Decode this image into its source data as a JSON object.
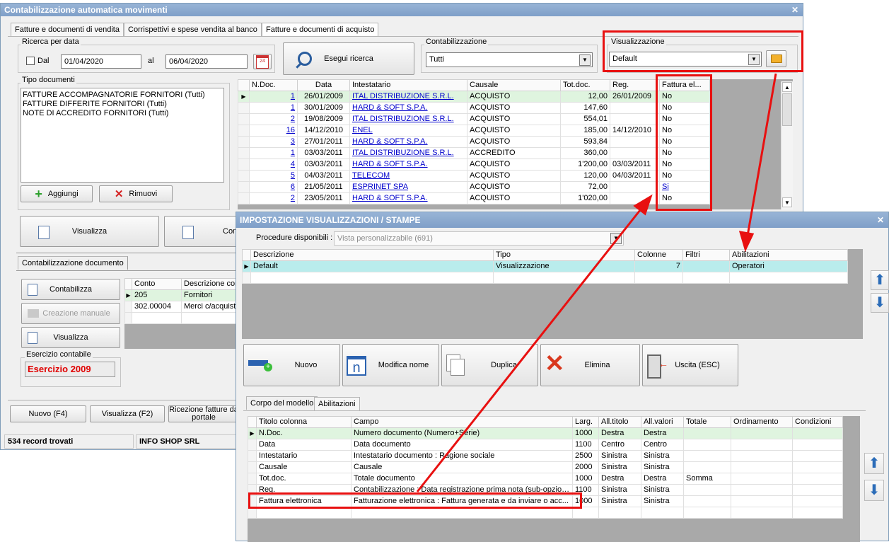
{
  "main_window": {
    "title": "Contabilizzazione automatica movimenti",
    "tabs": [
      "Fatture e documenti di vendita",
      "Corrispettivi e spese vendita al banco",
      "Fatture e documenti di acquisto"
    ],
    "ricerca": {
      "group_label": "Ricerca per data",
      "dal_label": "Dal",
      "from_date": "01/04/2020",
      "al_label": "al",
      "to_date": "06/04/2020",
      "calendar_badge": "24"
    },
    "esegui_label": "Esegui ricerca",
    "contabilizzazione": {
      "group_label": "Contabilizzazione",
      "value": "Tutti"
    },
    "visualizzazione": {
      "group_label": "Visualizzazione",
      "value": "Default"
    },
    "tipo_documenti": {
      "group_label": "Tipo documenti",
      "items": [
        "FATTURE ACCOMPAGNATORIE FORNITORI (Tutti)",
        "FATTURE DIFFERITE FORNITORI (Tutti)",
        "NOTE DI ACCREDITO FORNITORI (Tutti)"
      ],
      "add_label": "Aggiungi",
      "remove_label": "Rimuovi"
    },
    "grid": {
      "headers": [
        "N.Doc.",
        "Data",
        "Intestatario",
        "Causale",
        "Tot.doc.",
        "Reg.",
        "Fattura el..."
      ],
      "rows": [
        {
          "ndoc": "1",
          "data": "26/01/2009",
          "intestatario": "ITAL DISTRIBUZIONE S.R.L.",
          "causale": "ACQUISTO",
          "tot": "12,00",
          "reg": "26/01/2009",
          "fe": "No"
        },
        {
          "ndoc": "1",
          "data": "30/01/2009",
          "intestatario": "HARD & SOFT S.P.A.",
          "causale": "ACQUISTO",
          "tot": "147,60",
          "reg": "",
          "fe": "No"
        },
        {
          "ndoc": "2",
          "data": "19/08/2009",
          "intestatario": "ITAL DISTRIBUZIONE S.R.L.",
          "causale": "ACQUISTO",
          "tot": "554,01",
          "reg": "",
          "fe": "No"
        },
        {
          "ndoc": "16",
          "data": "14/12/2010",
          "intestatario": "ENEL",
          "causale": "ACQUISTO",
          "tot": "185,00",
          "reg": "14/12/2010",
          "fe": "No"
        },
        {
          "ndoc": "3",
          "data": "27/01/2011",
          "intestatario": "HARD & SOFT S.P.A.",
          "causale": "ACQUISTO",
          "tot": "593,84",
          "reg": "",
          "fe": "No"
        },
        {
          "ndoc": "1",
          "data": "03/03/2011",
          "intestatario": "ITAL DISTRIBUZIONE S.R.L.",
          "causale": "ACCREDITO",
          "tot": "360,00",
          "reg": "",
          "fe": "No"
        },
        {
          "ndoc": "4",
          "data": "03/03/2011",
          "intestatario": "HARD & SOFT S.P.A.",
          "causale": "ACQUISTO",
          "tot": "1'200,00",
          "reg": "03/03/2011",
          "fe": "No"
        },
        {
          "ndoc": "5",
          "data": "04/03/2011",
          "intestatario": "TELECOM",
          "causale": "ACQUISTO",
          "tot": "120,00",
          "reg": "04/03/2011",
          "fe": "No"
        },
        {
          "ndoc": "6",
          "data": "21/05/2011",
          "intestatario": "ESPRINET SPA",
          "causale": "ACQUISTO",
          "tot": "72,00",
          "reg": "",
          "fe": "Si"
        },
        {
          "ndoc": "2",
          "data": "23/05/2011",
          "intestatario": "HARD & SOFT S.P.A.",
          "causale": "ACQUISTO",
          "tot": "1'020,00",
          "reg": "",
          "fe": "No"
        }
      ]
    },
    "visualizza_label": "Visualizza",
    "con_partial_label": "Con",
    "contab_doc": {
      "tab_label": "Contabilizzazione documento",
      "contabilizza_label": "Contabilizza",
      "creazione_label": "Creazione manuale",
      "visualizza_label": "Visualizza",
      "headers": [
        "Conto",
        "Descrizione con"
      ],
      "rows": [
        [
          "205",
          "Fornitori"
        ],
        [
          "302.00004",
          "Merci c/acquisti"
        ]
      ],
      "esercizio_group": "Esercizio contabile",
      "esercizio_value": "Esercizio 2009"
    },
    "bottom_buttons": {
      "nuovo": "Nuovo (F4)",
      "visualizza": "Visualizza (F2)",
      "ricezione_line1": "Ricezione fatture da",
      "ricezione_line2": "portale"
    },
    "status": {
      "records": "534 record trovati",
      "company": "INFO SHOP SRL"
    }
  },
  "dialog": {
    "title": "IMPOSTAZIONE VISUALIZZAZIONI / STAMPE",
    "procedure_label": "Procedure disponibili :",
    "procedure_value": "Vista personalizzabile (691)",
    "views": {
      "headers": [
        "Descrizione",
        "Tipo",
        "Colonne",
        "Filtri",
        "Abilitazioni"
      ],
      "rows": [
        {
          "descrizione": "Default",
          "tipo": "Visualizzazione",
          "colonne": "7",
          "filtri": "",
          "abilitazioni": "Operatori"
        }
      ]
    },
    "buttons": {
      "nuovo": "Nuovo",
      "modifica": "Modifica nome",
      "duplica": "Duplica",
      "elimina": "Elimina",
      "uscita": "Uscita (ESC)"
    },
    "tabs": [
      "Corpo del modello",
      "Abilitazioni"
    ],
    "columns": {
      "headers": [
        "Titolo colonna",
        "Campo",
        "Larg.",
        "All.titolo",
        "All.valori",
        "Totale",
        "Ordinamento",
        "Condizioni"
      ],
      "rows": [
        {
          "titolo": "N.Doc.",
          "campo": "Numero documento (Numero+Serie)",
          "larg": "1000",
          "alltit": "Destra",
          "allval": "Destra",
          "tot": "",
          "ord": "",
          "cond": ""
        },
        {
          "titolo": "Data",
          "campo": "Data documento",
          "larg": "1100",
          "alltit": "Centro",
          "allval": "Centro",
          "tot": "",
          "ord": "",
          "cond": ""
        },
        {
          "titolo": "Intestatario",
          "campo": "Intestatario documento : Ragione sociale",
          "larg": "2500",
          "alltit": "Sinistra",
          "allval": "Sinistra",
          "tot": "",
          "ord": "",
          "cond": ""
        },
        {
          "titolo": "Causale",
          "campo": "Causale",
          "larg": "2000",
          "alltit": "Sinistra",
          "allval": "Sinistra",
          "tot": "",
          "ord": "",
          "cond": ""
        },
        {
          "titolo": "Tot.doc.",
          "campo": "Totale documento",
          "larg": "1000",
          "alltit": "Destra",
          "allval": "Destra",
          "tot": "Somma",
          "ord": "",
          "cond": ""
        },
        {
          "titolo": "Reg.",
          "campo": "Contabilizzazione : Data registrazione prima nota (sub-opzione)",
          "larg": "1100",
          "alltit": "Sinistra",
          "allval": "Sinistra",
          "tot": "",
          "ord": "",
          "cond": ""
        },
        {
          "titolo": "Fattura elettronica",
          "campo": "Fatturazione elettronica : Fattura generata e da inviare o acc...",
          "larg": "1000",
          "alltit": "Sinistra",
          "allval": "Sinistra",
          "tot": "",
          "ord": "",
          "cond": ""
        }
      ]
    }
  },
  "colors": {
    "highlight_red": "#e81010",
    "selected_row": "#dff4df",
    "selected_row_cyan": "#b9ecec",
    "title_blue": "#7f9fc8",
    "esercizio_red": "#e00000"
  }
}
